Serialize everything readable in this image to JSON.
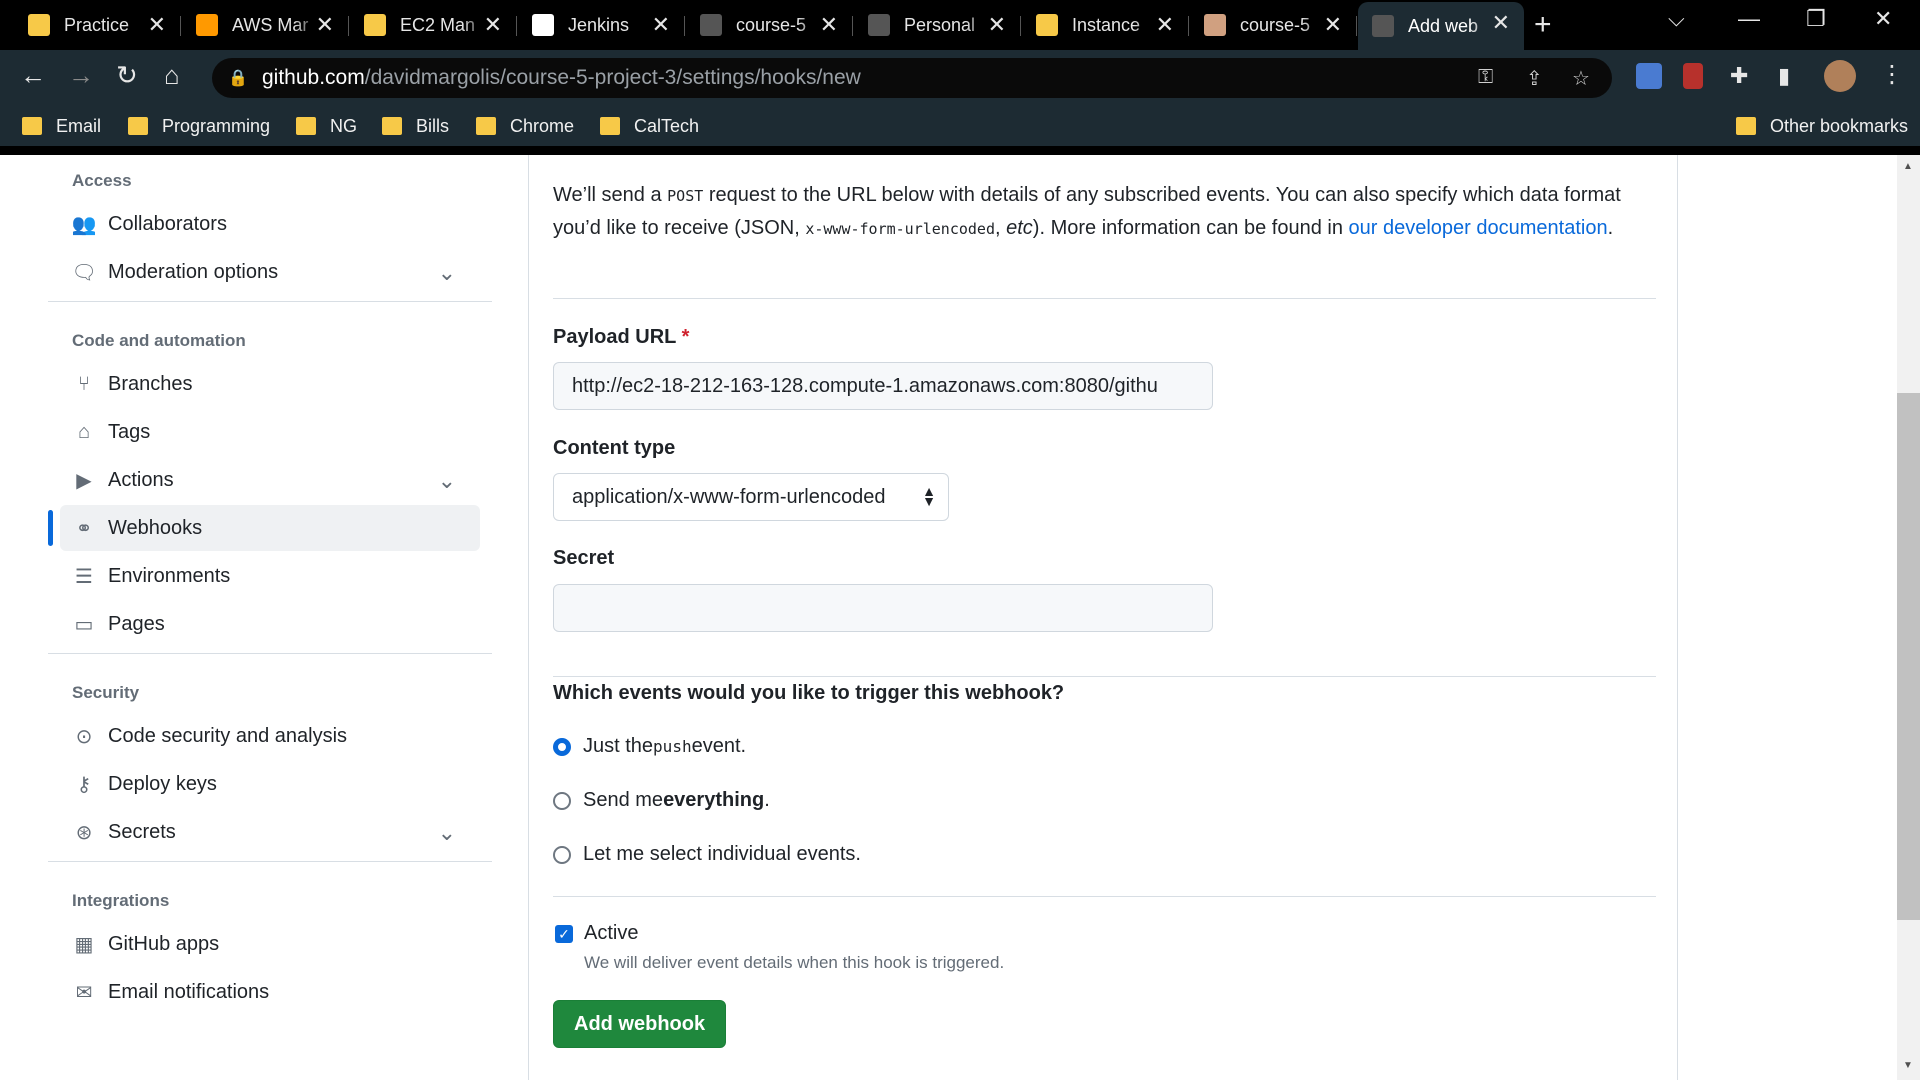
{
  "browser": {
    "tabs": [
      {
        "title": "Practice",
        "icon": "practice-icon",
        "color": "#f7c948"
      },
      {
        "title": "AWS Mar",
        "icon": "aws-cube-icon",
        "color": "#ff9900"
      },
      {
        "title": "EC2 Man",
        "icon": "aws-box-icon",
        "color": "#f7c948"
      },
      {
        "title": "Jenkins",
        "icon": "jenkins-icon",
        "color": "#ffffff"
      },
      {
        "title": "course-5",
        "icon": "github-icon",
        "color": "#555555"
      },
      {
        "title": "Personal",
        "icon": "github-icon",
        "color": "#555555"
      },
      {
        "title": "Instance",
        "icon": "aws-box-icon",
        "color": "#f7c948"
      },
      {
        "title": "course-5",
        "icon": "jenkins-butler-icon",
        "color": "#d0a080"
      },
      {
        "title": "Add web",
        "icon": "github-icon",
        "color": "#555555",
        "active": true
      }
    ],
    "url_domain": "github.com",
    "url_path": "/davidmargolis/course-5-project-3/settings/hooks/new",
    "bookmarks": [
      "Email",
      "Programming",
      "NG",
      "Bills",
      "Chrome",
      "CalTech"
    ],
    "other_bookmarks": "Other bookmarks"
  },
  "sidebar": {
    "sections": [
      {
        "heading": "Access",
        "items": [
          {
            "label": "Collaborators",
            "icon": "people-icon"
          },
          {
            "label": "Moderation options",
            "icon": "comment-discussion-icon",
            "expandable": true
          }
        ]
      },
      {
        "heading": "Code and automation",
        "items": [
          {
            "label": "Branches",
            "icon": "git-branch-icon"
          },
          {
            "label": "Tags",
            "icon": "tag-icon"
          },
          {
            "label": "Actions",
            "icon": "play-icon",
            "expandable": true
          },
          {
            "label": "Webhooks",
            "icon": "webhook-icon",
            "selected": true
          },
          {
            "label": "Environments",
            "icon": "server-icon"
          },
          {
            "label": "Pages",
            "icon": "browser-icon"
          }
        ]
      },
      {
        "heading": "Security",
        "items": [
          {
            "label": "Code security and analysis",
            "icon": "codescan-icon"
          },
          {
            "label": "Deploy keys",
            "icon": "key-icon"
          },
          {
            "label": "Secrets",
            "icon": "key-asterisk-icon",
            "expandable": true
          }
        ]
      },
      {
        "heading": "Integrations",
        "items": [
          {
            "label": "GitHub apps",
            "icon": "apps-icon"
          },
          {
            "label": "Email notifications",
            "icon": "mail-icon"
          }
        ]
      }
    ]
  },
  "form": {
    "intro_1": "We’ll send a ",
    "intro_post": "POST",
    "intro_2": " request to the URL below with details of any subscribed events. You can also specify which data format you’d like to receive (JSON, ",
    "intro_code": "x-www-form-urlencoded",
    "intro_3": ", ",
    "intro_etc": "etc",
    "intro_4": "). More information can be found in ",
    "intro_link": "our developer documentation",
    "intro_5": ".",
    "payload_label": "Payload URL",
    "payload_required": "*",
    "payload_value": "http://ec2-18-212-163-128.compute-1.amazonaws.com:8080/githu",
    "content_type_label": "Content type",
    "content_type_value": "application/x-www-form-urlencoded",
    "secret_label": "Secret",
    "secret_value": "",
    "events_question": "Which events would you like to trigger this webhook?",
    "event_push_pre": "Just the ",
    "event_push_code": "push",
    "event_push_post": " event.",
    "event_all_pre": "Send me ",
    "event_all_bold": "everything",
    "event_all_post": ".",
    "event_select": "Let me select individual events.",
    "active_label": "Active",
    "active_note": "We will deliver event details when this hook is triggered.",
    "submit_label": "Add webhook"
  }
}
